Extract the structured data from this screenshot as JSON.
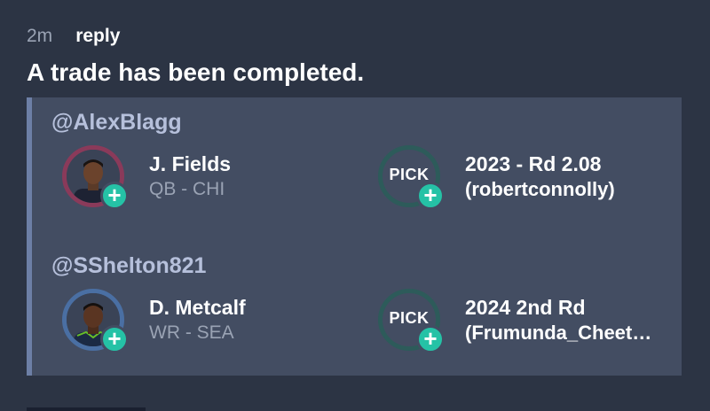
{
  "meta": {
    "time": "2m",
    "reply_label": "reply"
  },
  "message": "A trade has been completed.",
  "trade": {
    "sides": [
      {
        "owner": "@AlexBlagg",
        "player": {
          "name": "J. Fields",
          "position_team": "QB - CHI",
          "add_icon": "plus-icon"
        },
        "pick": {
          "badge": "PICK",
          "title": "2023 - Rd 2.08",
          "owner": "(robertconnolly)",
          "add_icon": "plus-icon"
        }
      },
      {
        "owner": "@SShelton821",
        "player": {
          "name": "D. Metcalf",
          "position_team": "WR - SEA",
          "add_icon": "plus-icon"
        },
        "pick": {
          "badge": "PICK",
          "title": "2024 2nd Rd",
          "owner": "(Frumunda_Cheet…",
          "add_icon": "plus-icon"
        }
      }
    ]
  },
  "colors": {
    "background": "#2c3444",
    "card": "#434d62",
    "accent_plus": "#25c2a6",
    "owner_text": "#b6c0db",
    "bears_ring": "#8a3a5a",
    "seahawks_ring": "#4a6fa3",
    "pick_ring": "#2d5b5a"
  }
}
